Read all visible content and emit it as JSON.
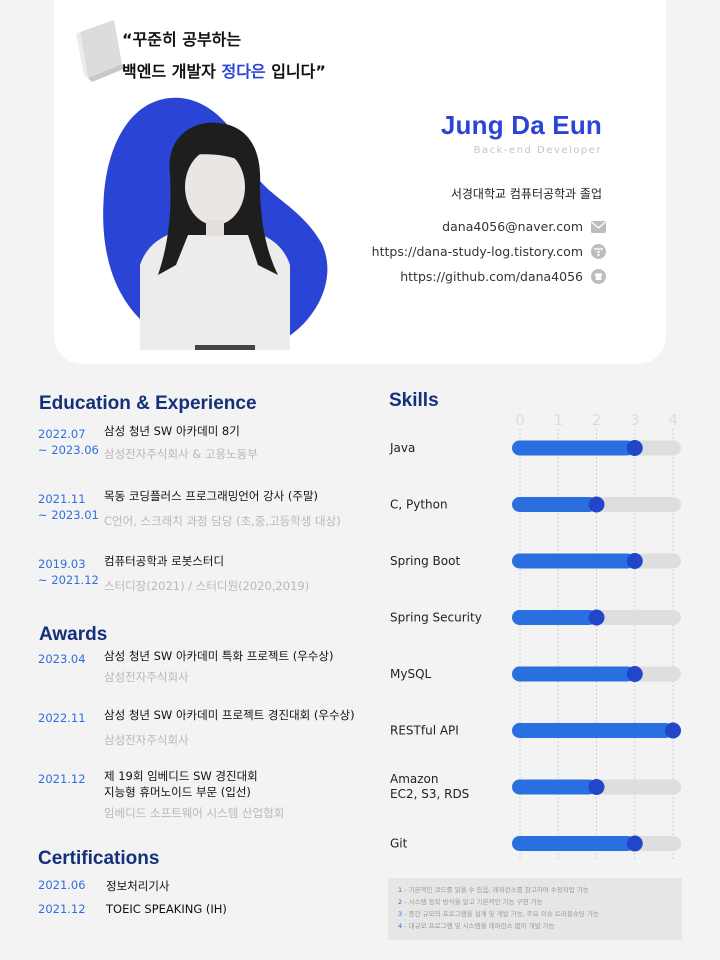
{
  "header": {
    "quote_line1": "“꾸준히 공부하는",
    "quote_line2_prefix": "백엔드 개발자 ",
    "quote_line2_highlight": "정다은",
    "quote_line2_suffix": " 입니다”",
    "name": "Jung Da Eun",
    "role": "Back-end Developer",
    "school": "서경대학교 컴퓨터공학과 졸업",
    "contacts": [
      {
        "text": "dana4056@naver.com",
        "icon": "mail-icon"
      },
      {
        "text": "https://dana-study-log.tistory.com",
        "icon": "tistory-icon"
      },
      {
        "text": "https://github.com/dana4056",
        "icon": "github-icon"
      }
    ],
    "accent_color": "#2a45d6"
  },
  "education": {
    "title": "Education & Experience",
    "items": [
      {
        "date1": "2022.07",
        "date2": "~ 2023.06",
        "title": "삼성 청년 SW 아카데미 8기",
        "sub": "삼성전자주식회사 & 고용노동부"
      },
      {
        "date1": "2021.11",
        "date2": "~ 2023.01",
        "title": "목동 코딩플러스 프로그래밍언어 강사 (주말)",
        "sub": "C언어, 스크래치 과정 담당 (초,중,고등학생 대상)"
      },
      {
        "date1": "2019.03",
        "date2": "~ 2021.12",
        "title": "컴퓨터공학과 로봇스터디",
        "sub": "스터디장(2021) / 스터디원(2020,2019)"
      }
    ]
  },
  "awards": {
    "title": "Awards",
    "items": [
      {
        "date": "2023.04",
        "title": "삼성 청년 SW 아카데미 특화 프로젝트 (우수상)",
        "title2": "",
        "sub": "삼성전자주식회사"
      },
      {
        "date": "2022.11",
        "title": "삼성 청년 SW 아카데미 프로젝트 경진대회 (우수상)",
        "title2": "",
        "sub": "삼성전자주식회사"
      },
      {
        "date": "2021.12",
        "title": "제 19회 임베디드 SW 경진대회",
        "title2": "지능형 휴머노이드 부문 (입선)",
        "sub": "임베디드 소프트웨어 시스템 산업협회"
      }
    ]
  },
  "certifications": {
    "title": "Certifications",
    "items": [
      {
        "date": "2021.06",
        "name": "정보처리기사"
      },
      {
        "date": "2021.12",
        "name": "TOEIC SPEAKING (IH)"
      }
    ]
  },
  "skills": {
    "title": "Skills",
    "legend": [
      {
        "num": "1",
        "text": " - 기본적인 코드를 읽을 수 있음, 레퍼런스를 참고하여 수정작업 가능"
      },
      {
        "num": "2",
        "text": " - 시스템 동작 방식을 알고 기본적인 기능 구현 가능"
      },
      {
        "num": "3",
        "text": " - 중간 규모의 프로그램을 설계 및 개발 가능, 주요 이슈 트러블슈팅 가능"
      },
      {
        "num": "4",
        "text": " - 대규모 프로그램 및 시스템을 레퍼런스 없이 개발 가능"
      }
    ]
  },
  "chart_data": {
    "type": "bar",
    "orientation": "horizontal",
    "x_ticks": [
      "0",
      "1",
      "2",
      "3",
      "4"
    ],
    "xlim": [
      0,
      4
    ],
    "categories": [
      "Java",
      "C, Python",
      "Spring Boot",
      "Spring Security",
      "MySQL",
      "RESTful API",
      "Amazon\nEC2, S3, RDS",
      "Git"
    ],
    "values": [
      3,
      2,
      3,
      2,
      3,
      4,
      2,
      3
    ],
    "bar_color": "#2a6fe0",
    "track_color": "#dedede",
    "grid": "dotted vertical"
  }
}
